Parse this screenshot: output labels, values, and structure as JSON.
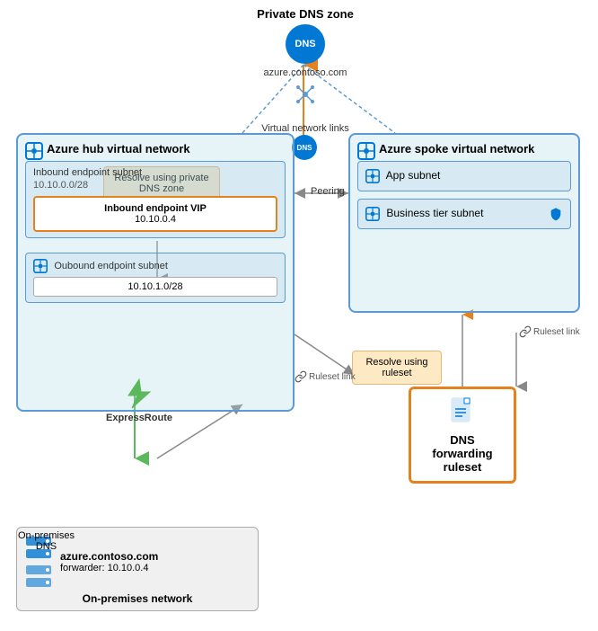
{
  "privateDnsZone": {
    "label": "Private DNS zone",
    "circleText": "DNS",
    "url": "azure.contoso.com",
    "vnetLinksLabel": "Virtual network links"
  },
  "hubVnet": {
    "title": "Azure hub virtual network",
    "inboundSubnet": {
      "title": "Inbound endpoint subnet",
      "cidr": "10.10.0.0/28",
      "vipBox": {
        "title": "Inbound endpoint VIP",
        "ip": "10.10.0.4"
      }
    },
    "outboundSubnet": {
      "title": "Oubound endpoint subnet",
      "ip": "10.10.1.0/28"
    }
  },
  "spokeVnet": {
    "title": "Azure spoke virtual network",
    "appSubnet": {
      "label": "App subnet"
    },
    "businessSubnet": {
      "label": "Business tier subnet"
    }
  },
  "resolvePrivate": {
    "text": "Resolve using private DNS zone"
  },
  "resolveRuleset": {
    "text": "Resolve using ruleset"
  },
  "rulesetBox": {
    "title": "DNS forwarding ruleset"
  },
  "rulesetLinkLabel1": "Ruleset link",
  "rulesetLinkLabel2": "Ruleset link",
  "peeringLabel": "Peering",
  "expressRoute": {
    "label": "ExpressRoute"
  },
  "onPremises": {
    "domain": "azure.contoso.com",
    "forwarder": "forwarder: 10.10.0.4",
    "networkLabel": "On-premises network",
    "dnsLabel": "On-premises\nDNS"
  },
  "dnsSmallLabel": "DNS"
}
